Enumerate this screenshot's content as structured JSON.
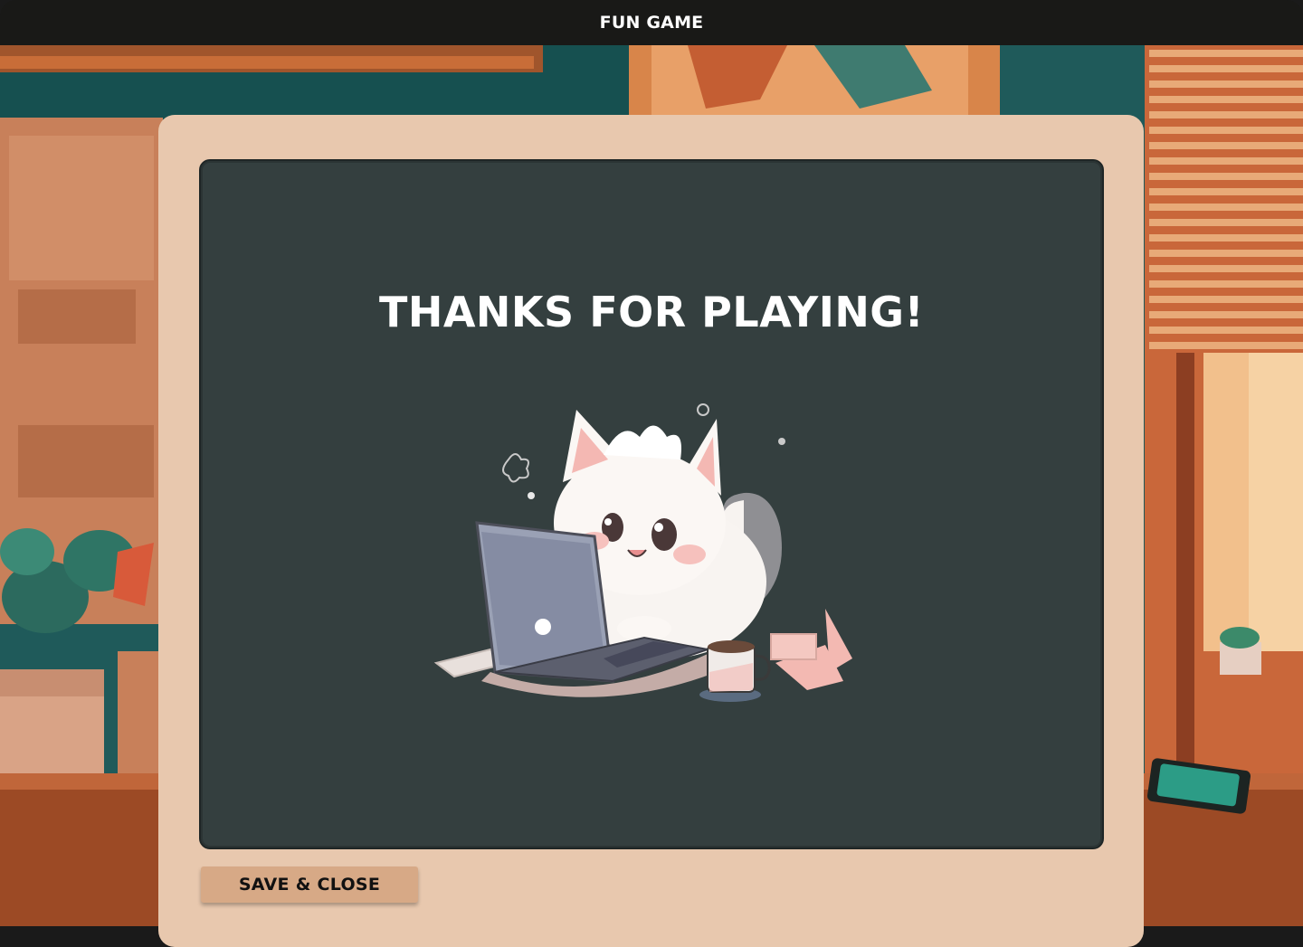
{
  "window": {
    "title": "FUN GAME"
  },
  "screen": {
    "headline": "THANKS FOR PLAYING!",
    "illustration": "cat-typing-on-laptop-illustration"
  },
  "actions": {
    "save_close_label": "SAVE & CLOSE"
  },
  "colors": {
    "titlebar": "#191917",
    "panel": "#e8c8ae",
    "screen": "#343f3f",
    "button": "#d7a986",
    "headline_text": "#ffffff"
  }
}
